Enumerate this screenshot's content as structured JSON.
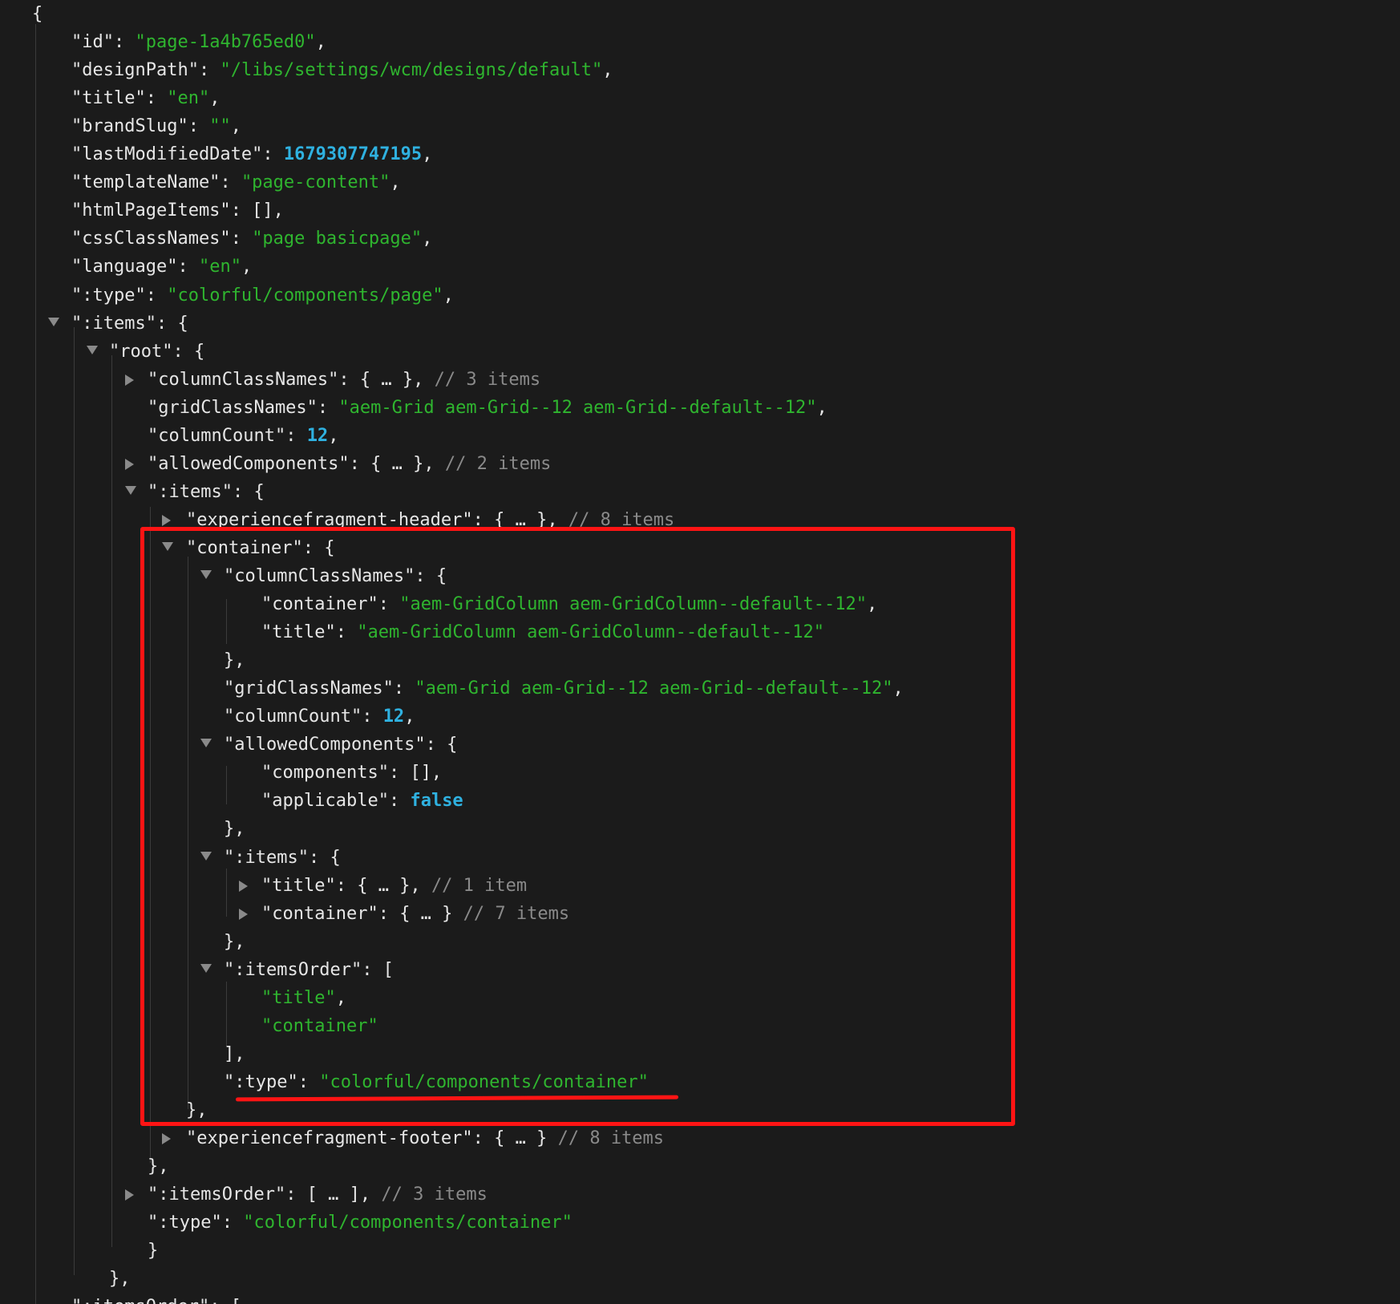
{
  "annotation_color": "#ff1414",
  "colors": {
    "background": "#1b1b1b",
    "key": "#e6e6e6",
    "string": "#2fb52f",
    "number": "#2fb1e0",
    "comment": "#8a8a8a"
  },
  "rows": [
    {
      "t": "",
      "parts": [
        [
          "p",
          "{"
        ]
      ]
    },
    {
      "t": null,
      "parts": [
        [
          "k",
          "\"id\""
        ],
        [
          "p",
          ": "
        ],
        [
          "s",
          "\"page-1a4b765ed0\""
        ],
        [
          "p",
          ","
        ]
      ]
    },
    {
      "t": null,
      "parts": [
        [
          "k",
          "\"designPath\""
        ],
        [
          "p",
          ": "
        ],
        [
          "s",
          "\"/libs/settings/wcm/designs/default\""
        ],
        [
          "p",
          ","
        ]
      ]
    },
    {
      "t": null,
      "parts": [
        [
          "k",
          "\"title\""
        ],
        [
          "p",
          ": "
        ],
        [
          "s",
          "\"en\""
        ],
        [
          "p",
          ","
        ]
      ]
    },
    {
      "t": null,
      "parts": [
        [
          "k",
          "\"brandSlug\""
        ],
        [
          "p",
          ": "
        ],
        [
          "s",
          "\"\""
        ],
        [
          "p",
          ","
        ]
      ]
    },
    {
      "t": null,
      "parts": [
        [
          "k",
          "\"lastModifiedDate\""
        ],
        [
          "p",
          ": "
        ],
        [
          "n",
          "1679307747195"
        ],
        [
          "p",
          ","
        ]
      ]
    },
    {
      "t": null,
      "parts": [
        [
          "k",
          "\"templateName\""
        ],
        [
          "p",
          ": "
        ],
        [
          "s",
          "\"page-content\""
        ],
        [
          "p",
          ","
        ]
      ]
    },
    {
      "t": null,
      "parts": [
        [
          "k",
          "\"htmlPageItems\""
        ],
        [
          "p",
          ": [],"
        ]
      ]
    },
    {
      "t": null,
      "parts": [
        [
          "k",
          "\"cssClassNames\""
        ],
        [
          "p",
          ": "
        ],
        [
          "s",
          "\"page basicpage\""
        ],
        [
          "p",
          ","
        ]
      ]
    },
    {
      "t": null,
      "parts": [
        [
          "k",
          "\"language\""
        ],
        [
          "p",
          ": "
        ],
        [
          "s",
          "\"en\""
        ],
        [
          "p",
          ","
        ]
      ]
    },
    {
      "t": null,
      "parts": [
        [
          "k",
          "\":type\""
        ],
        [
          "p",
          ": "
        ],
        [
          "s",
          "\"colorful/components/page\""
        ],
        [
          "p",
          ","
        ]
      ]
    },
    {
      "t": "down",
      "parts": [
        [
          "k",
          "\":items\""
        ],
        [
          "p",
          ": {"
        ]
      ]
    },
    {
      "t": "down",
      "parts": [
        [
          "k",
          "\"root\""
        ],
        [
          "p",
          ": {"
        ]
      ]
    },
    {
      "t": "right",
      "parts": [
        [
          "k",
          "\"columnClassNames\""
        ],
        [
          "p",
          ": { … }, "
        ],
        [
          "c",
          "// 3 items"
        ]
      ]
    },
    {
      "t": null,
      "parts": [
        [
          "k",
          "\"gridClassNames\""
        ],
        [
          "p",
          ": "
        ],
        [
          "s",
          "\"aem-Grid aem-Grid--12 aem-Grid--default--12\""
        ],
        [
          "p",
          ","
        ]
      ]
    },
    {
      "t": null,
      "parts": [
        [
          "k",
          "\"columnCount\""
        ],
        [
          "p",
          ": "
        ],
        [
          "n",
          "12"
        ],
        [
          "p",
          ","
        ]
      ]
    },
    {
      "t": "right",
      "parts": [
        [
          "k",
          "\"allowedComponents\""
        ],
        [
          "p",
          ": { … }, "
        ],
        [
          "c",
          "// 2 items"
        ]
      ]
    },
    {
      "t": "down",
      "parts": [
        [
          "k",
          "\":items\""
        ],
        [
          "p",
          ": {"
        ]
      ]
    },
    {
      "t": "right",
      "parts": [
        [
          "k",
          "\"experiencefragment-header\""
        ],
        [
          "p",
          ": { … }, "
        ],
        [
          "c",
          "// 8 items"
        ]
      ]
    },
    {
      "t": "down",
      "parts": [
        [
          "k",
          "\"container\""
        ],
        [
          "p",
          ": {"
        ]
      ]
    },
    {
      "t": "down",
      "parts": [
        [
          "k",
          "\"columnClassNames\""
        ],
        [
          "p",
          ": {"
        ]
      ]
    },
    {
      "t": null,
      "parts": [
        [
          "k",
          "\"container\""
        ],
        [
          "p",
          ": "
        ],
        [
          "s",
          "\"aem-GridColumn aem-GridColumn--default--12\""
        ],
        [
          "p",
          ","
        ]
      ]
    },
    {
      "t": null,
      "parts": [
        [
          "k",
          "\"title\""
        ],
        [
          "p",
          ": "
        ],
        [
          "s",
          "\"aem-GridColumn aem-GridColumn--default--12\""
        ]
      ]
    },
    {
      "t": null,
      "parts": [
        [
          "p",
          "},"
        ]
      ]
    },
    {
      "t": null,
      "parts": [
        [
          "k",
          "\"gridClassNames\""
        ],
        [
          "p",
          ": "
        ],
        [
          "s",
          "\"aem-Grid aem-Grid--12 aem-Grid--default--12\""
        ],
        [
          "p",
          ","
        ]
      ]
    },
    {
      "t": null,
      "parts": [
        [
          "k",
          "\"columnCount\""
        ],
        [
          "p",
          ": "
        ],
        [
          "n",
          "12"
        ],
        [
          "p",
          ","
        ]
      ]
    },
    {
      "t": "down",
      "parts": [
        [
          "k",
          "\"allowedComponents\""
        ],
        [
          "p",
          ": {"
        ]
      ]
    },
    {
      "t": null,
      "parts": [
        [
          "k",
          "\"components\""
        ],
        [
          "p",
          ": [],"
        ]
      ]
    },
    {
      "t": null,
      "parts": [
        [
          "k",
          "\"applicable\""
        ],
        [
          "p",
          ": "
        ],
        [
          "n",
          "false"
        ]
      ]
    },
    {
      "t": null,
      "parts": [
        [
          "p",
          "},"
        ]
      ]
    },
    {
      "t": "down",
      "parts": [
        [
          "k",
          "\":items\""
        ],
        [
          "p",
          ": {"
        ]
      ]
    },
    {
      "t": "right",
      "parts": [
        [
          "k",
          "\"title\""
        ],
        [
          "p",
          ": { … }, "
        ],
        [
          "c",
          "// 1 item"
        ]
      ]
    },
    {
      "t": "right",
      "parts": [
        [
          "k",
          "\"container\""
        ],
        [
          "p",
          ": { … } "
        ],
        [
          "c",
          "// 7 items"
        ]
      ]
    },
    {
      "t": null,
      "parts": [
        [
          "p",
          "},"
        ]
      ]
    },
    {
      "t": "down",
      "parts": [
        [
          "k",
          "\":itemsOrder\""
        ],
        [
          "p",
          ": ["
        ]
      ]
    },
    {
      "t": null,
      "parts": [
        [
          "s",
          "\"title\""
        ],
        [
          "p",
          ","
        ]
      ]
    },
    {
      "t": null,
      "parts": [
        [
          "s",
          "\"container\""
        ]
      ]
    },
    {
      "t": null,
      "parts": [
        [
          "p",
          "],"
        ]
      ]
    },
    {
      "t": null,
      "parts": [
        [
          "k",
          "\":type\""
        ],
        [
          "p",
          ": "
        ],
        [
          "s",
          "\"colorful/components/container\""
        ]
      ]
    },
    {
      "t": null,
      "parts": [
        [
          "p",
          "},"
        ]
      ]
    },
    {
      "t": "right",
      "parts": [
        [
          "k",
          "\"experiencefragment-footer\""
        ],
        [
          "p",
          ": { … } "
        ],
        [
          "c",
          "// 8 items"
        ]
      ]
    },
    {
      "t": null,
      "parts": [
        [
          "p",
          "},"
        ]
      ]
    },
    {
      "t": "right",
      "parts": [
        [
          "k",
          "\":itemsOrder\""
        ],
        [
          "p",
          ": [ … ], "
        ],
        [
          "c",
          "// 3 items"
        ]
      ]
    },
    {
      "t": null,
      "parts": [
        [
          "k",
          "\":type\""
        ],
        [
          "p",
          ": "
        ],
        [
          "s",
          "\"colorful/components/container\""
        ]
      ]
    },
    {
      "t": null,
      "parts": [
        [
          "p",
          "}"
        ]
      ]
    },
    {
      "t": null,
      "parts": [
        [
          "p",
          "},"
        ]
      ]
    },
    {
      "t": null,
      "parts": [
        [
          "k",
          "\":itemsOrder\""
        ],
        [
          "p",
          ": ["
        ]
      ]
    }
  ]
}
